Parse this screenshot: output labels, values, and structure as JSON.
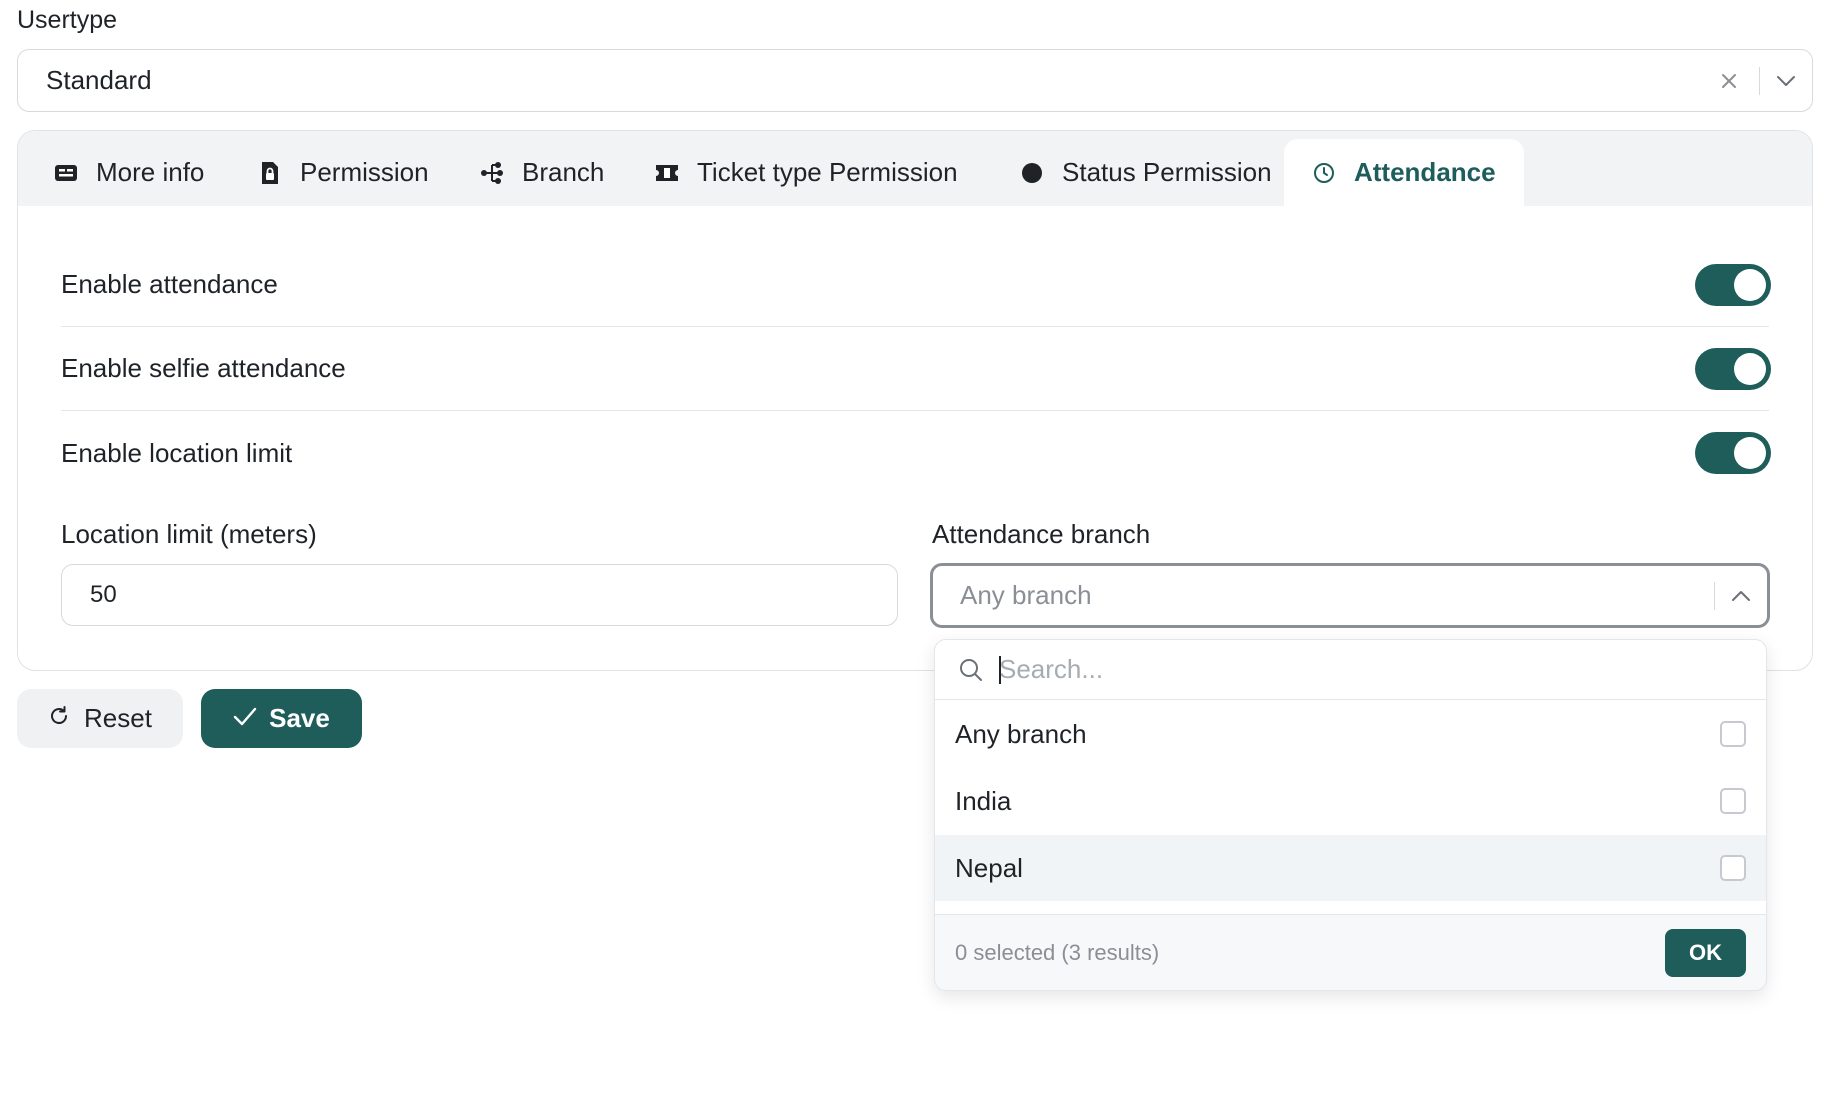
{
  "usertype": {
    "label": "Usertype",
    "value": "Standard"
  },
  "tabs": [
    {
      "label": "More info",
      "icon": "id-card-icon"
    },
    {
      "label": "Permission",
      "icon": "file-lock-icon"
    },
    {
      "label": "Branch",
      "icon": "sitemap-icon"
    },
    {
      "label": "Ticket type Permission",
      "icon": "ticket-icon"
    },
    {
      "label": "Status Permission",
      "icon": "circle-icon"
    },
    {
      "label": "Attendance",
      "icon": "clock-icon",
      "active": true
    }
  ],
  "attendance": {
    "toggles": [
      {
        "label": "Enable attendance",
        "on": true
      },
      {
        "label": "Enable selfie attendance",
        "on": true
      },
      {
        "label": "Enable location limit",
        "on": true
      }
    ],
    "location_limit": {
      "label": "Location limit (meters)",
      "value": "50"
    },
    "branch": {
      "label": "Attendance branch",
      "placeholder": "Any branch"
    }
  },
  "dropdown": {
    "search_placeholder": "Search...",
    "options": [
      {
        "label": "Any branch",
        "checked": false
      },
      {
        "label": "India",
        "checked": false
      },
      {
        "label": "Nepal",
        "checked": false
      }
    ],
    "summary": "0 selected (3 results)",
    "ok_label": "OK"
  },
  "actions": {
    "reset_label": "Reset",
    "save_label": "Save"
  },
  "colors": {
    "accent": "#1f5d5b",
    "tabbar_bg": "#f2f3f4",
    "highlight_row": "#f1f4f7"
  }
}
